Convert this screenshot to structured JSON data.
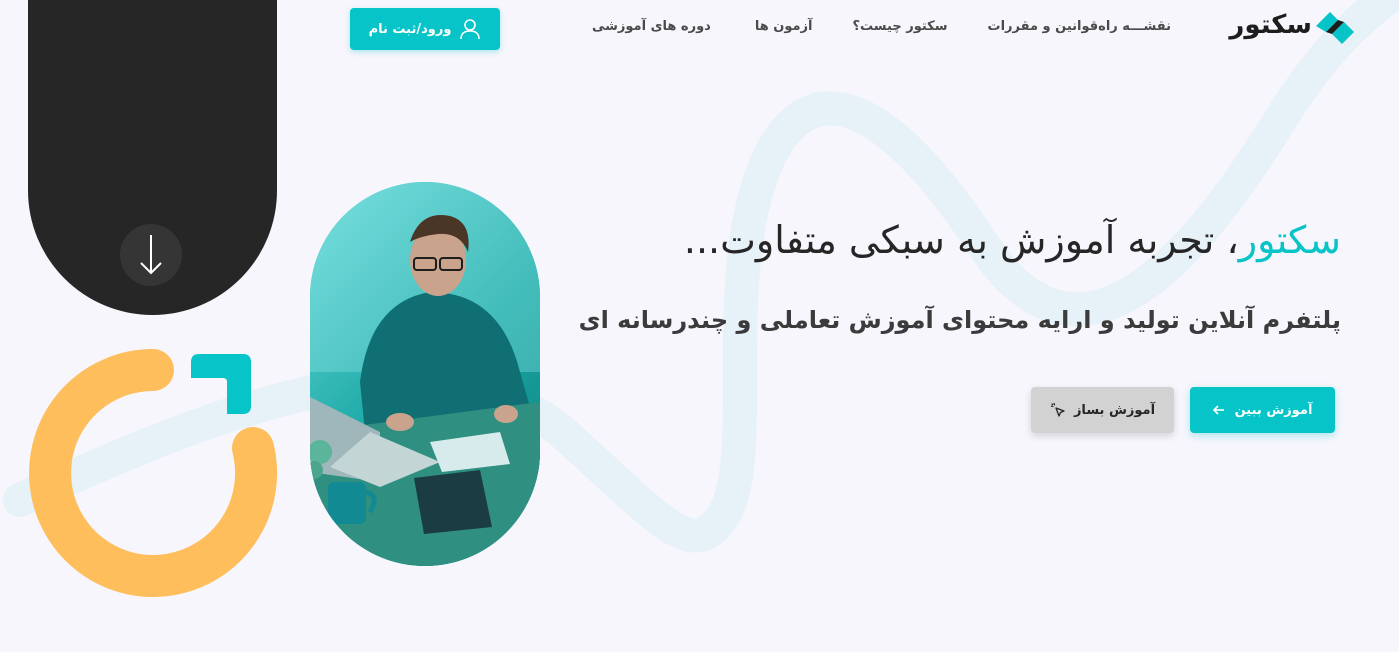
{
  "header": {
    "logo_text": "سکتور",
    "nav": [
      {
        "label": "دوره های آموزشی"
      },
      {
        "label": "آزمون ها"
      },
      {
        "label": "سکتور چیست؟"
      },
      {
        "label": "قوانین و مقررات"
      },
      {
        "label": "نقشـــه راه"
      }
    ],
    "login_label": "ورود/ثبت نام"
  },
  "hero": {
    "title_accent": "سکتور",
    "title_rest": "، تجربه آموزش به سبکی متفاوت...",
    "subtitle": "پلتفرم آنلاین تولید و ارایه محتوای آموزش تعاملی و چندرسانه ای",
    "primary_button": "آموزش ببین",
    "secondary_button": "آموزش بساز"
  },
  "colors": {
    "accent": "#06c4c8",
    "dark": "#262626",
    "yellow": "#ffbe5c",
    "background": "#f6f6fc"
  },
  "icons": {
    "logo": "sector-logo-icon",
    "login": "user-icon",
    "scroll": "arrow-down-icon",
    "primary": "arrow-left-icon",
    "secondary": "cursor-click-icon"
  }
}
